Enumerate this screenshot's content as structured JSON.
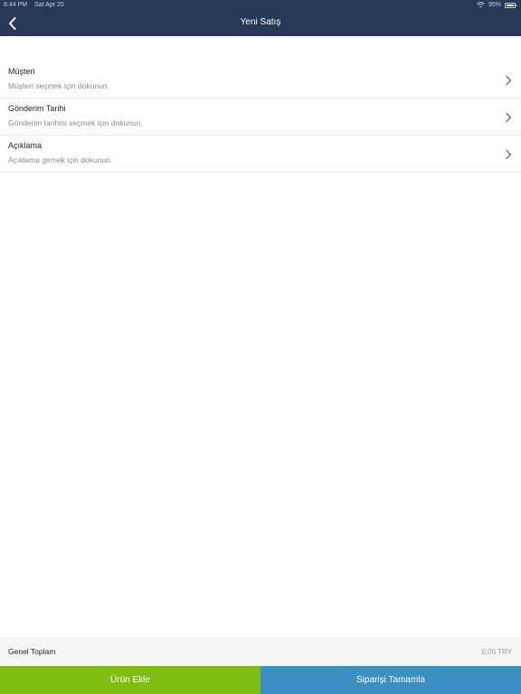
{
  "status_bar": {
    "time": "6:44 PM",
    "date": "Sat Apr 20",
    "battery": "95%",
    "battery_level": 0.95
  },
  "header": {
    "title": "Yeni Satış",
    "back_icon": "chevron-left-icon"
  },
  "rows": [
    {
      "title": "Müşteri",
      "subtitle": "Müşteri seçmek için dokunun."
    },
    {
      "title": "Gönderim Tarihi",
      "subtitle": "Gönderim tarihini seçmek için dokunun."
    },
    {
      "title": "Açıklama",
      "subtitle": "Açıklama girmek için dokunun."
    }
  ],
  "total": {
    "label": "Genel Toplam",
    "value": "0,00 TRY"
  },
  "buttons": {
    "add_product": "Ürün Ekle",
    "complete_order": "Siparişi Tamamla"
  },
  "colors": {
    "header": "#283857",
    "add_button": "#7fbd12",
    "complete_button": "#3b8fc1"
  }
}
